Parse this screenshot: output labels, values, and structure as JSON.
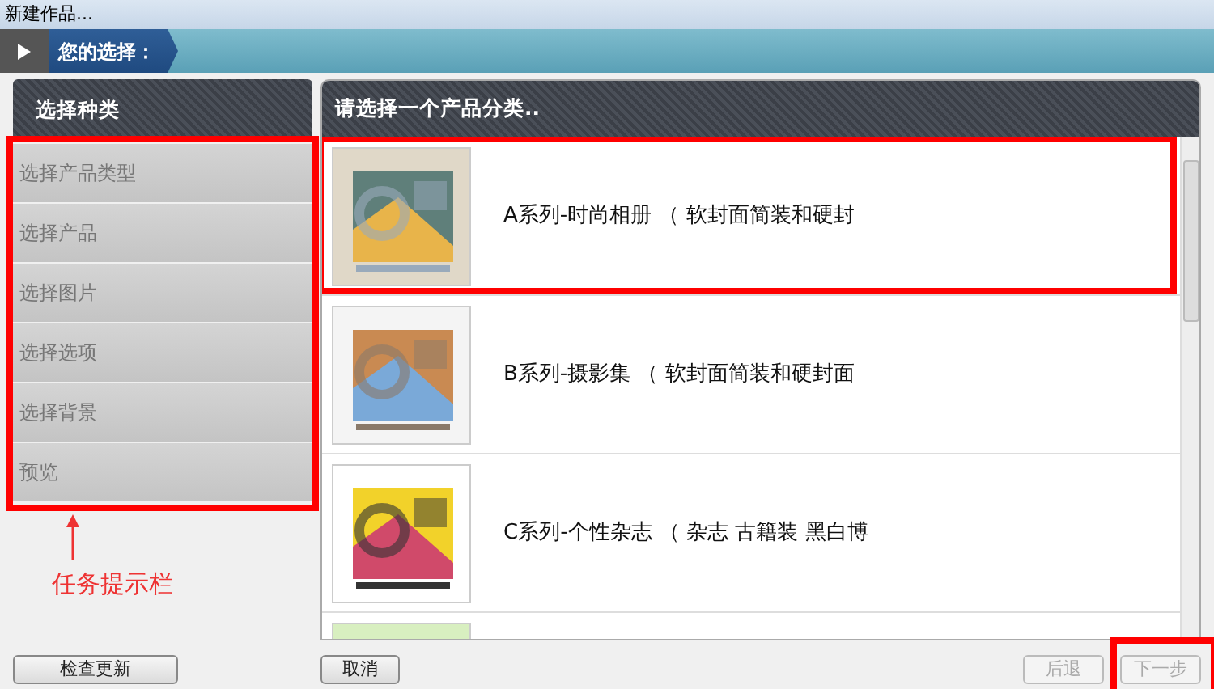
{
  "window": {
    "title": "新建作品..."
  },
  "banner": {
    "label": "您的选择："
  },
  "sidebar": {
    "current_step": "选择种类",
    "steps": [
      {
        "label": "选择产品类型"
      },
      {
        "label": "选择产品"
      },
      {
        "label": "选择图片"
      },
      {
        "label": "选择选项"
      },
      {
        "label": "选择背景"
      },
      {
        "label": "预览"
      }
    ]
  },
  "annotation": {
    "label": "任务提示栏"
  },
  "content": {
    "heading": "请选择一个产品分类..",
    "items": [
      {
        "title": "A系列-时尚相册 （ 软封面简装和硬封",
        "thumbnail": {
          "kind": "picture"
        }
      },
      {
        "title": "B系列-摄影集 （ 软封面简装和硬封面",
        "thumbnail": {
          "kind": "picture"
        }
      },
      {
        "title": "C系列-个性杂志 （ 杂志 古籍装 黑白博",
        "thumbnail": {
          "kind": "picture"
        }
      },
      {
        "thumbnail": {
          "kind": "picture"
        }
      }
    ]
  },
  "buttons": [
    {
      "label": "检查更新",
      "disabled": false
    },
    {
      "label": "取消",
      "disabled": false
    },
    {
      "label": "后退",
      "disabled": true
    },
    {
      "label": "下一步",
      "disabled": true
    }
  ]
}
